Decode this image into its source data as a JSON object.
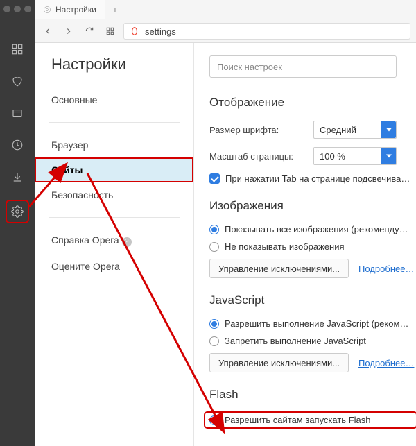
{
  "window": {
    "tab_title": "Настройки",
    "address": "settings"
  },
  "rail": {
    "icons": [
      "grid",
      "heart",
      "tabs",
      "clock",
      "download",
      "gear"
    ]
  },
  "sidenav": {
    "title": "Настройки",
    "items": [
      {
        "label": "Основные",
        "active": false
      },
      {
        "label": "Браузер",
        "active": false
      },
      {
        "label": "Сайты",
        "active": true
      },
      {
        "label": "Безопасность",
        "active": false
      }
    ],
    "secondary": [
      {
        "label": "Справка Opera",
        "help": true
      },
      {
        "label": "Оцените Opera",
        "help": false
      }
    ]
  },
  "panel": {
    "search_placeholder": "Поиск настроек",
    "display": {
      "title": "Отображение",
      "font_label": "Размер шрифта:",
      "font_value": "Средний",
      "zoom_label": "Масштаб страницы:",
      "zoom_value": "100 %",
      "tab_highlight": "При нажатии Tab на странице подсвечива…"
    },
    "images": {
      "title": "Изображения",
      "opt1": "Показывать все изображения (рекоменду…",
      "opt2": "Не показывать изображения",
      "manage": "Управление исключениями...",
      "more": "Подробнее…"
    },
    "js": {
      "title": "JavaScript",
      "opt1": "Разрешить выполнение JavaScript (реком…",
      "opt2": "Запретить выполнение JavaScript",
      "manage": "Управление исключениями...",
      "more": "Подробнее…"
    },
    "flash": {
      "title": "Flash",
      "opt1": "Разрешить сайтам запускать Flash"
    }
  }
}
